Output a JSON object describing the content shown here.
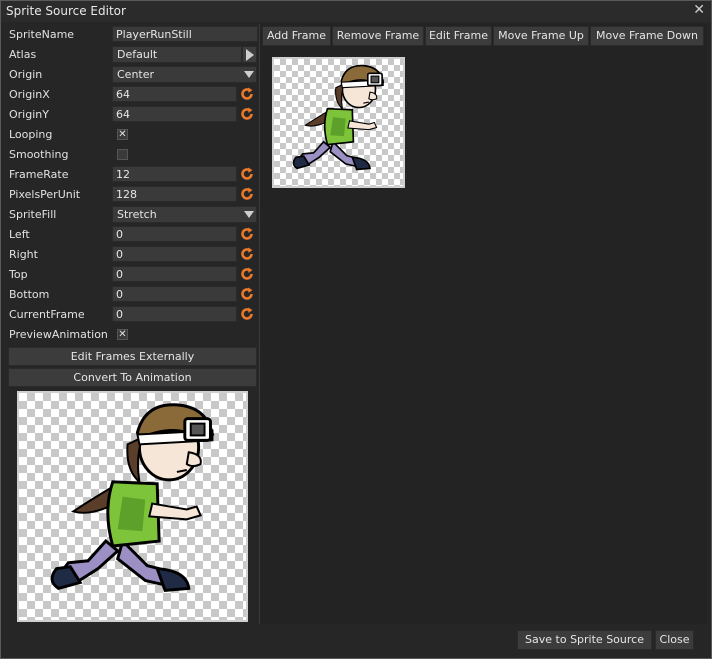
{
  "window": {
    "title": "Sprite Source Editor",
    "close_glyph": "✕"
  },
  "properties": {
    "sprite_name": {
      "label": "SpriteName",
      "value": "PlayerRunStill"
    },
    "atlas": {
      "label": "Atlas",
      "value": "Default"
    },
    "origin": {
      "label": "Origin",
      "value": "Center"
    },
    "origin_x": {
      "label": "OriginX",
      "value": "64"
    },
    "origin_y": {
      "label": "OriginY",
      "value": "64"
    },
    "looping": {
      "label": "Looping",
      "checked": true,
      "mark": "✕"
    },
    "smoothing": {
      "label": "Smoothing",
      "checked": false
    },
    "frame_rate": {
      "label": "FrameRate",
      "value": "12"
    },
    "pixels_per_unit": {
      "label": "PixelsPerUnit",
      "value": "128"
    },
    "sprite_fill": {
      "label": "SpriteFill",
      "value": "Stretch"
    },
    "left": {
      "label": "Left",
      "value": "0"
    },
    "right": {
      "label": "Right",
      "value": "0"
    },
    "top": {
      "label": "Top",
      "value": "0"
    },
    "bottom": {
      "label": "Bottom",
      "value": "0"
    },
    "current_frame": {
      "label": "CurrentFrame",
      "value": "0"
    },
    "preview_animation": {
      "label": "PreviewAnimation",
      "checked": true,
      "mark": "✕"
    }
  },
  "actions": {
    "edit_frames_externally": "Edit Frames Externally",
    "convert_to_animation": "Convert To Animation"
  },
  "toolbar": {
    "add_frame": "Add Frame",
    "remove_frame": "Remove Frame",
    "edit_frame": "Edit Frame",
    "move_frame_up": "Move Frame Up",
    "move_frame_down": "Move Frame Down"
  },
  "footer": {
    "save": "Save to Sprite Source",
    "close": "Close"
  },
  "icons": {
    "reset": "reset-icon",
    "dropdown": "chevron-down-icon",
    "atlas_pick": "play-arrow-icon"
  },
  "colors": {
    "reset_icon": "#e8792a",
    "background": "#262626",
    "field": "#3a3a3a"
  }
}
